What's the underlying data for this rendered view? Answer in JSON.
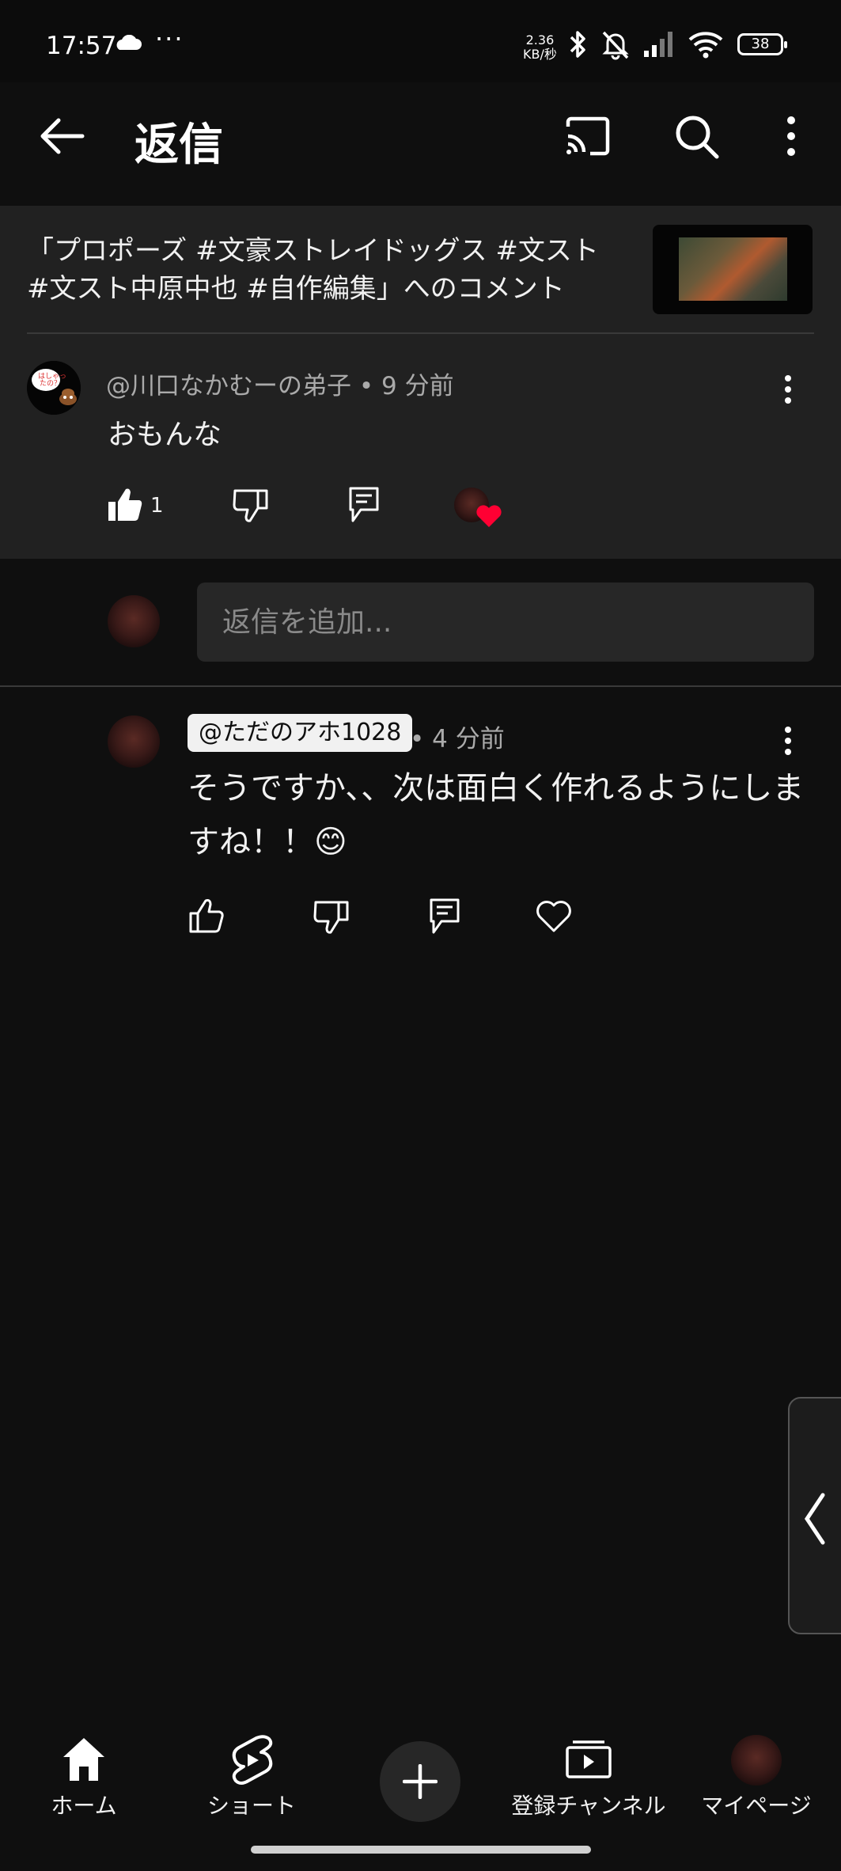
{
  "status_bar": {
    "time": "17:57",
    "dots": "···",
    "speed_value": "2.36",
    "speed_unit": "KB/秒",
    "battery": "38"
  },
  "app_bar": {
    "title": "返信",
    "icons": [
      "back-arrow-icon",
      "cast-icon",
      "search-icon",
      "more-vert-icon"
    ]
  },
  "video": {
    "title": "「プロポーズ #文豪ストレイドッグス #文スト #文スト中原中也 #自作編集」へのコメント"
  },
  "parent_comment": {
    "author": "@川口なかむーの弟子",
    "separator": "•",
    "time": "9 分前",
    "text": "おもんな",
    "like_count": "1",
    "creator_heart": true
  },
  "reply_box": {
    "placeholder": "返信を追加..."
  },
  "reply": {
    "mention": "@ただのアホ1028",
    "separator": "•",
    "time": "4 分前",
    "text": "そうですか、、次は面白く作れるようにしますね！！😊"
  },
  "bottom_nav": {
    "items": [
      {
        "label": "ホーム",
        "icon": "home-icon"
      },
      {
        "label": "ショート",
        "icon": "shorts-icon"
      },
      {
        "label": "",
        "icon": "create-plus-icon"
      },
      {
        "label": "登録チャンネル",
        "icon": "subscriptions-icon"
      },
      {
        "label": "マイページ",
        "icon": "avatar"
      }
    ]
  },
  "colors": {
    "background": "#0f0f0f",
    "panel": "#212121",
    "text_primary": "#f1f1f1",
    "text_secondary": "#aaaaaa",
    "heart_red": "#ff0033"
  }
}
